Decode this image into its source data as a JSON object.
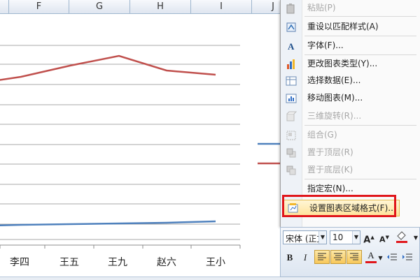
{
  "spreadsheet": {
    "columns": [
      "F",
      "G",
      "H",
      "I",
      "J"
    ]
  },
  "chart": {
    "categories": [
      "李四",
      "王五",
      "王九",
      "赵六",
      "王小"
    ],
    "series": [
      {
        "color": "#c0504d",
        "values": [
          0.84,
          0.88,
          0.92,
          0.86,
          0.84,
          0.82
        ]
      },
      {
        "color": "#4f81bd",
        "values": [
          0.11,
          0.115,
          0.12,
          0.12,
          0.125,
          0.13
        ]
      }
    ],
    "legend_colors": [
      "#4f81bd",
      "#c0504d"
    ]
  },
  "context_menu": {
    "items": [
      {
        "label": "粘贴(P)",
        "icon": "paste-icon",
        "enabled": false
      },
      {
        "label": "重设以匹配样式(A)",
        "icon": "reset-style-icon",
        "enabled": true
      },
      {
        "label": "字体(F)...",
        "icon": "font-icon",
        "enabled": true
      },
      {
        "label": "更改图表类型(Y)...",
        "icon": "chart-type-icon",
        "enabled": true
      },
      {
        "label": "选择数据(E)...",
        "icon": "select-data-icon",
        "enabled": true
      },
      {
        "label": "移动图表(M)...",
        "icon": "move-chart-icon",
        "enabled": true
      },
      {
        "label": "三维旋转(R)...",
        "icon": "3d-rotate-icon",
        "enabled": false
      },
      {
        "label": "组合(G)",
        "icon": "group-icon",
        "enabled": false
      },
      {
        "label": "置于顶层(R)",
        "icon": "bring-front-icon",
        "enabled": false
      },
      {
        "label": "置于底层(K)",
        "icon": "send-back-icon",
        "enabled": false
      },
      {
        "label": "指定宏(N)...",
        "icon": "macro-icon",
        "enabled": true
      },
      {
        "label": "设置图表区域格式(F)...",
        "icon": "format-chart-area-icon",
        "enabled": true,
        "highlighted": true
      }
    ]
  },
  "mini_toolbar": {
    "font_name": "宋体 (正文",
    "font_size": "10",
    "grow_font_label": "A",
    "shrink_font_label": "A",
    "bold_label": "B",
    "italic_label": "I",
    "font_color_label": "A",
    "accent_red": "#e0161b"
  }
}
